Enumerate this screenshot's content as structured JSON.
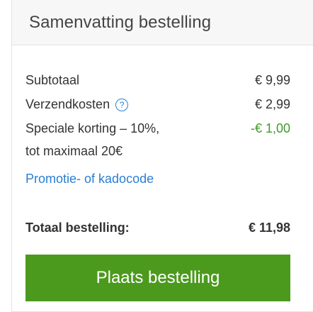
{
  "summary": {
    "title": "Samenvatting bestelling",
    "subtotal_label": "Subtotaal",
    "subtotal_value": "€ 9,99",
    "shipping_label": "Verzendkosten",
    "shipping_help_icon": "question-circle-icon",
    "shipping_value": "€ 2,99",
    "discount_label_line1": "Speciale korting – 10%,",
    "discount_label_line2": "tot maximaal 20€",
    "discount_value": "-€ 1,00",
    "promo_link": "Promotie- of kadocode",
    "total_label": "Totaal bestelling:",
    "total_value": "€ 11,98",
    "order_button": "Plaats bestelling"
  },
  "colors": {
    "accent_green": "#4c9a1d",
    "discount_green": "#3f9a2b",
    "link_blue": "#2a7fd4"
  }
}
